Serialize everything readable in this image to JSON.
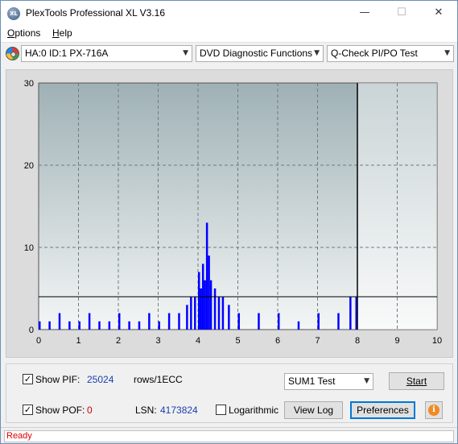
{
  "window": {
    "title": "PlexTools Professional XL V3.16",
    "app_icon_text": "XL",
    "minimize_glyph": "—",
    "maximize_glyph": "☐",
    "close_glyph": "✕"
  },
  "menu": {
    "items": [
      {
        "label": "Options",
        "first": "O",
        "rest": "ptions"
      },
      {
        "label": "Help",
        "first": "H",
        "rest": "elp"
      }
    ]
  },
  "toolbar": {
    "drive_icon": "disc-icon",
    "drive_select": "HA:0 ID:1  PX-716A",
    "function_select": "DVD Diagnostic Functions",
    "test_select": "Q-Check PI/PO Test",
    "arrow_glyph": "▼"
  },
  "chart_data": {
    "type": "bar",
    "title": "",
    "xlabel": "",
    "ylabel": "",
    "xlim": [
      0,
      10
    ],
    "ylim": [
      0,
      30
    ],
    "x_ticks": [
      0,
      1,
      2,
      3,
      4,
      5,
      6,
      7,
      8,
      9,
      10
    ],
    "y_ticks": [
      0,
      10,
      20,
      30
    ],
    "grid": true,
    "threshold_line": 4,
    "end_marker_x": 8,
    "series": [
      {
        "color": "#0000ff",
        "x": [
          0.0,
          0.25,
          0.5,
          0.75,
          1.0,
          1.25,
          1.5,
          1.75,
          2.0,
          2.25,
          2.5,
          2.75,
          3.0,
          3.25,
          3.5,
          3.7,
          3.8,
          3.9,
          4.0,
          4.05,
          4.1,
          4.15,
          4.2,
          4.25,
          4.3,
          4.4,
          4.5,
          4.6,
          4.75,
          5.0,
          5.5,
          6.0,
          6.5,
          7.0,
          7.5,
          7.8,
          7.95
        ],
        "values": [
          1,
          1,
          2,
          1,
          1,
          2,
          1,
          1,
          2,
          1,
          1,
          2,
          1,
          2,
          2,
          3,
          4,
          4,
          7,
          5,
          8,
          6,
          13,
          9,
          6,
          5,
          4,
          4,
          3,
          2,
          2,
          2,
          1,
          2,
          2,
          4,
          4
        ]
      }
    ]
  },
  "controls": {
    "show_pif_label": "Show PIF:",
    "pif_value": "25024",
    "pif_unit": "rows/1ECC",
    "show_pof_label": "Show POF:",
    "pof_value": "0",
    "lsn_label": "LSN:",
    "lsn_value": "4173824",
    "logarithmic_label": "Logarithmic",
    "sum_select": "SUM1 Test",
    "start_button": "Start",
    "view_log_button": "View Log",
    "preferences_button": "Preferences",
    "check_glyph": "✓",
    "info_glyph": "i"
  },
  "status": {
    "text": "Ready",
    "color": "#e00000"
  }
}
